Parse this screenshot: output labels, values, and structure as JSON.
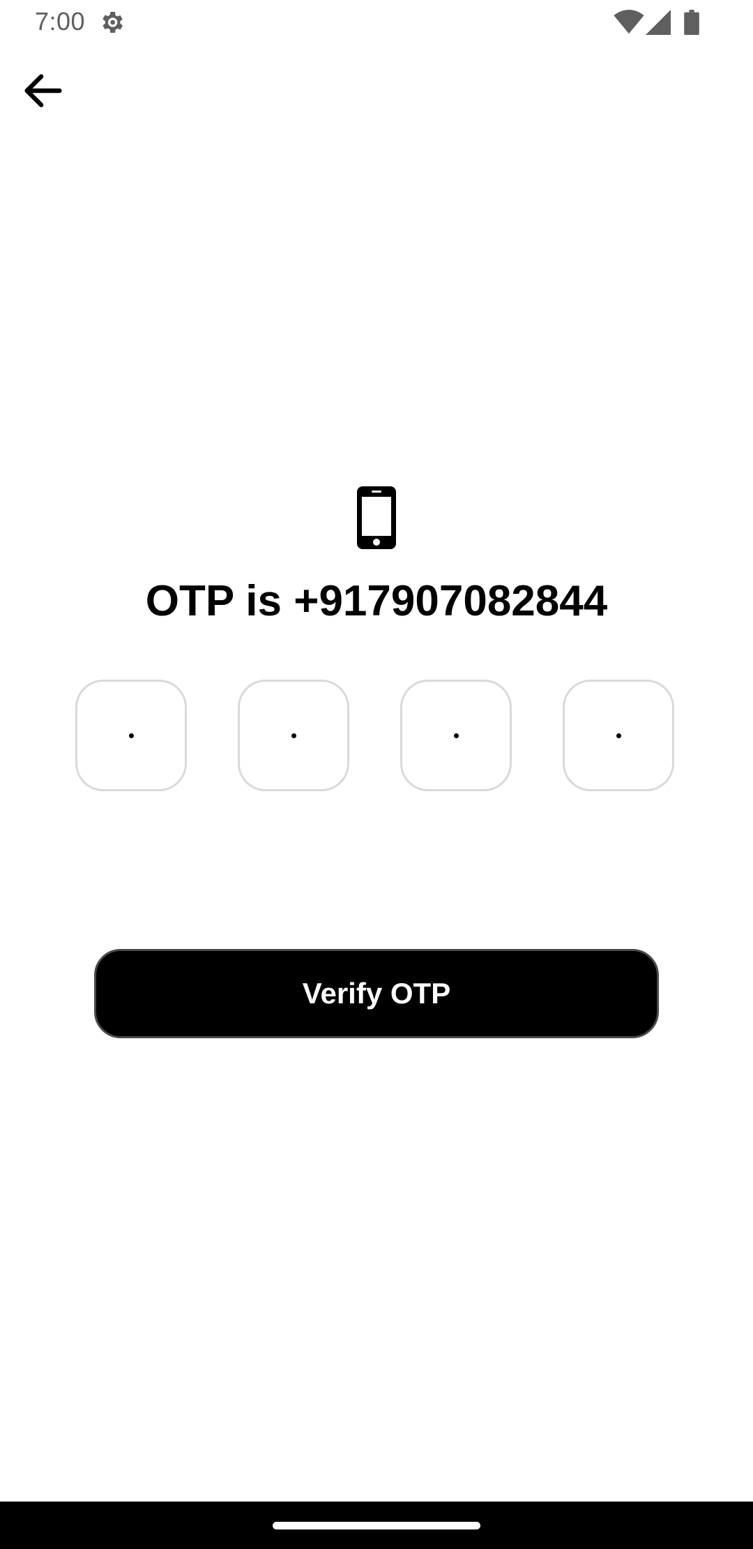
{
  "status_bar": {
    "time": "7:00",
    "icons": [
      "gear-icon",
      "wifi-icon",
      "signal-icon",
      "battery-icon"
    ]
  },
  "header": {
    "back_icon": "arrow-left-icon"
  },
  "main": {
    "phone_icon": "smartphone-icon",
    "title": "OTP is +917907082844",
    "otp_digits": [
      "",
      "",
      "",
      ""
    ],
    "verify_label": "Verify OTP"
  },
  "colors": {
    "background": "#ffffff",
    "button": "#000000",
    "button_text": "#ffffff",
    "otp_border": "#d9d9d9",
    "status_text": "#5f5f5f"
  }
}
